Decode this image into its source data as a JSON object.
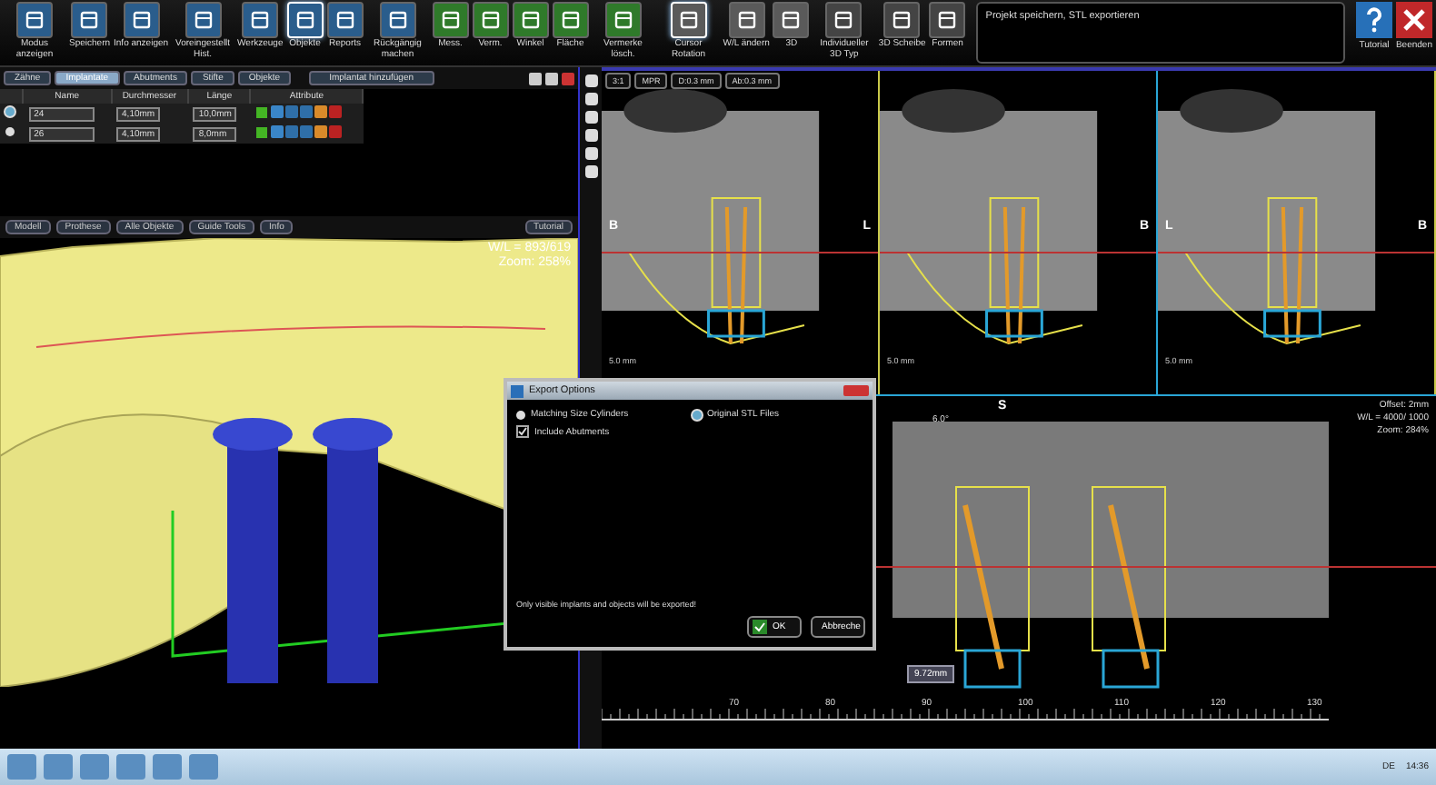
{
  "toolbar": {
    "buttons": [
      {
        "label": "Modus anzeigen",
        "kind": "file",
        "selected": false
      },
      {
        "label": "Speichern",
        "kind": "file",
        "selected": false
      },
      {
        "label": "Info anzeigen",
        "kind": "file",
        "selected": false
      },
      {
        "label": "Voreingestellt Hist.",
        "kind": "file",
        "selected": false
      },
      {
        "label": "Werkzeuge",
        "kind": "file",
        "selected": false
      },
      {
        "label": "Objekte",
        "kind": "file",
        "selected": true
      },
      {
        "label": "Reports",
        "kind": "file",
        "selected": false
      },
      {
        "label": "Rückgängig machen",
        "kind": "file",
        "selected": false
      },
      {
        "label": "Mess.",
        "kind": "measure",
        "selected": false
      },
      {
        "label": "Verm.",
        "kind": "measure",
        "selected": false
      },
      {
        "label": "Winkel",
        "kind": "measure",
        "selected": false
      },
      {
        "label": "Fläche",
        "kind": "measure",
        "selected": false
      },
      {
        "label": "Vermerke lösch.",
        "kind": "measure",
        "selected": false
      },
      {
        "label": "Cursor Rotation",
        "kind": "view",
        "selected": true
      },
      {
        "label": "W/L ändern",
        "kind": "view",
        "selected": false
      },
      {
        "label": "3D",
        "kind": "view",
        "selected": false
      },
      {
        "label": "Individueller 3D Typ",
        "kind": "tool",
        "selected": false
      },
      {
        "label": "3D Scheibe",
        "kind": "tool",
        "selected": false
      },
      {
        "label": "Formen",
        "kind": "tool",
        "selected": false
      }
    ],
    "message": "Projekt speichern, STL exportieren",
    "right_buttons": [
      {
        "label": "Tutorial",
        "kind": "help"
      },
      {
        "label": "Beenden",
        "kind": "close"
      }
    ]
  },
  "implant_tabs": [
    {
      "label": "Zähne",
      "selected": false
    },
    {
      "label": "Implantate",
      "selected": true
    },
    {
      "label": "Abutments",
      "selected": false
    },
    {
      "label": "Stifte",
      "selected": false
    },
    {
      "label": "Objekte",
      "selected": false
    }
  ],
  "add_button": "Implantat hinzufügen",
  "table": {
    "columns": [
      "Name",
      "Durchmesser",
      "Länge",
      "Attribute"
    ],
    "rows": [
      {
        "selected": true,
        "name": "24",
        "diameter": "4,10mm",
        "length": "10,0mm",
        "color": "#44b524"
      },
      {
        "selected": false,
        "name": "26",
        "diameter": "4,10mm",
        "length": "8,0mm",
        "color": "#44b524"
      }
    ]
  },
  "view_tabs": [
    {
      "label": "Modell"
    },
    {
      "label": "Prothese"
    },
    {
      "label": "Alle Objekte"
    },
    {
      "label": "Guide Tools"
    },
    {
      "label": "Info"
    }
  ],
  "tutorial_button": "Tutorial",
  "model_view": {
    "wl": "W/L = 893/619",
    "zoom": "Zoom: 258%"
  },
  "ct_controls": [
    "3:1",
    "MPR",
    "D:0.3 mm",
    "Ab:0.3 mm"
  ],
  "slices": [
    {
      "left": "B",
      "right": "L",
      "scale": "5.0 mm"
    },
    {
      "right": "B",
      "scale": "5.0 mm"
    },
    {
      "left": "L",
      "right": "B",
      "scale": "5.0 mm"
    }
  ],
  "panorama": {
    "label": "S",
    "angle": "6.0°",
    "offset": "Offset: 2mm",
    "wl": "W/L = 4000/ 1000",
    "zoom": "Zoom: 284%",
    "measure": "9.72mm",
    "ticks": [
      "70",
      "80",
      "90",
      "100",
      "110",
      "120",
      "130"
    ]
  },
  "dialog": {
    "title": "Export Options",
    "options": [
      {
        "kind": "radio",
        "label": "Matching Size Cylinders",
        "selected": false
      },
      {
        "kind": "radio",
        "label": "Original STL Files",
        "selected": true
      },
      {
        "kind": "checkbox",
        "label": "Include Abutments",
        "checked": true
      }
    ],
    "note": "Only visible implants and objects will be exported!",
    "buttons": [
      {
        "label": "OK",
        "kind": "ok"
      },
      {
        "label": "Abbreche",
        "kind": "cancel"
      }
    ]
  },
  "taskbar": {
    "language": "DE",
    "time": "14:36"
  }
}
